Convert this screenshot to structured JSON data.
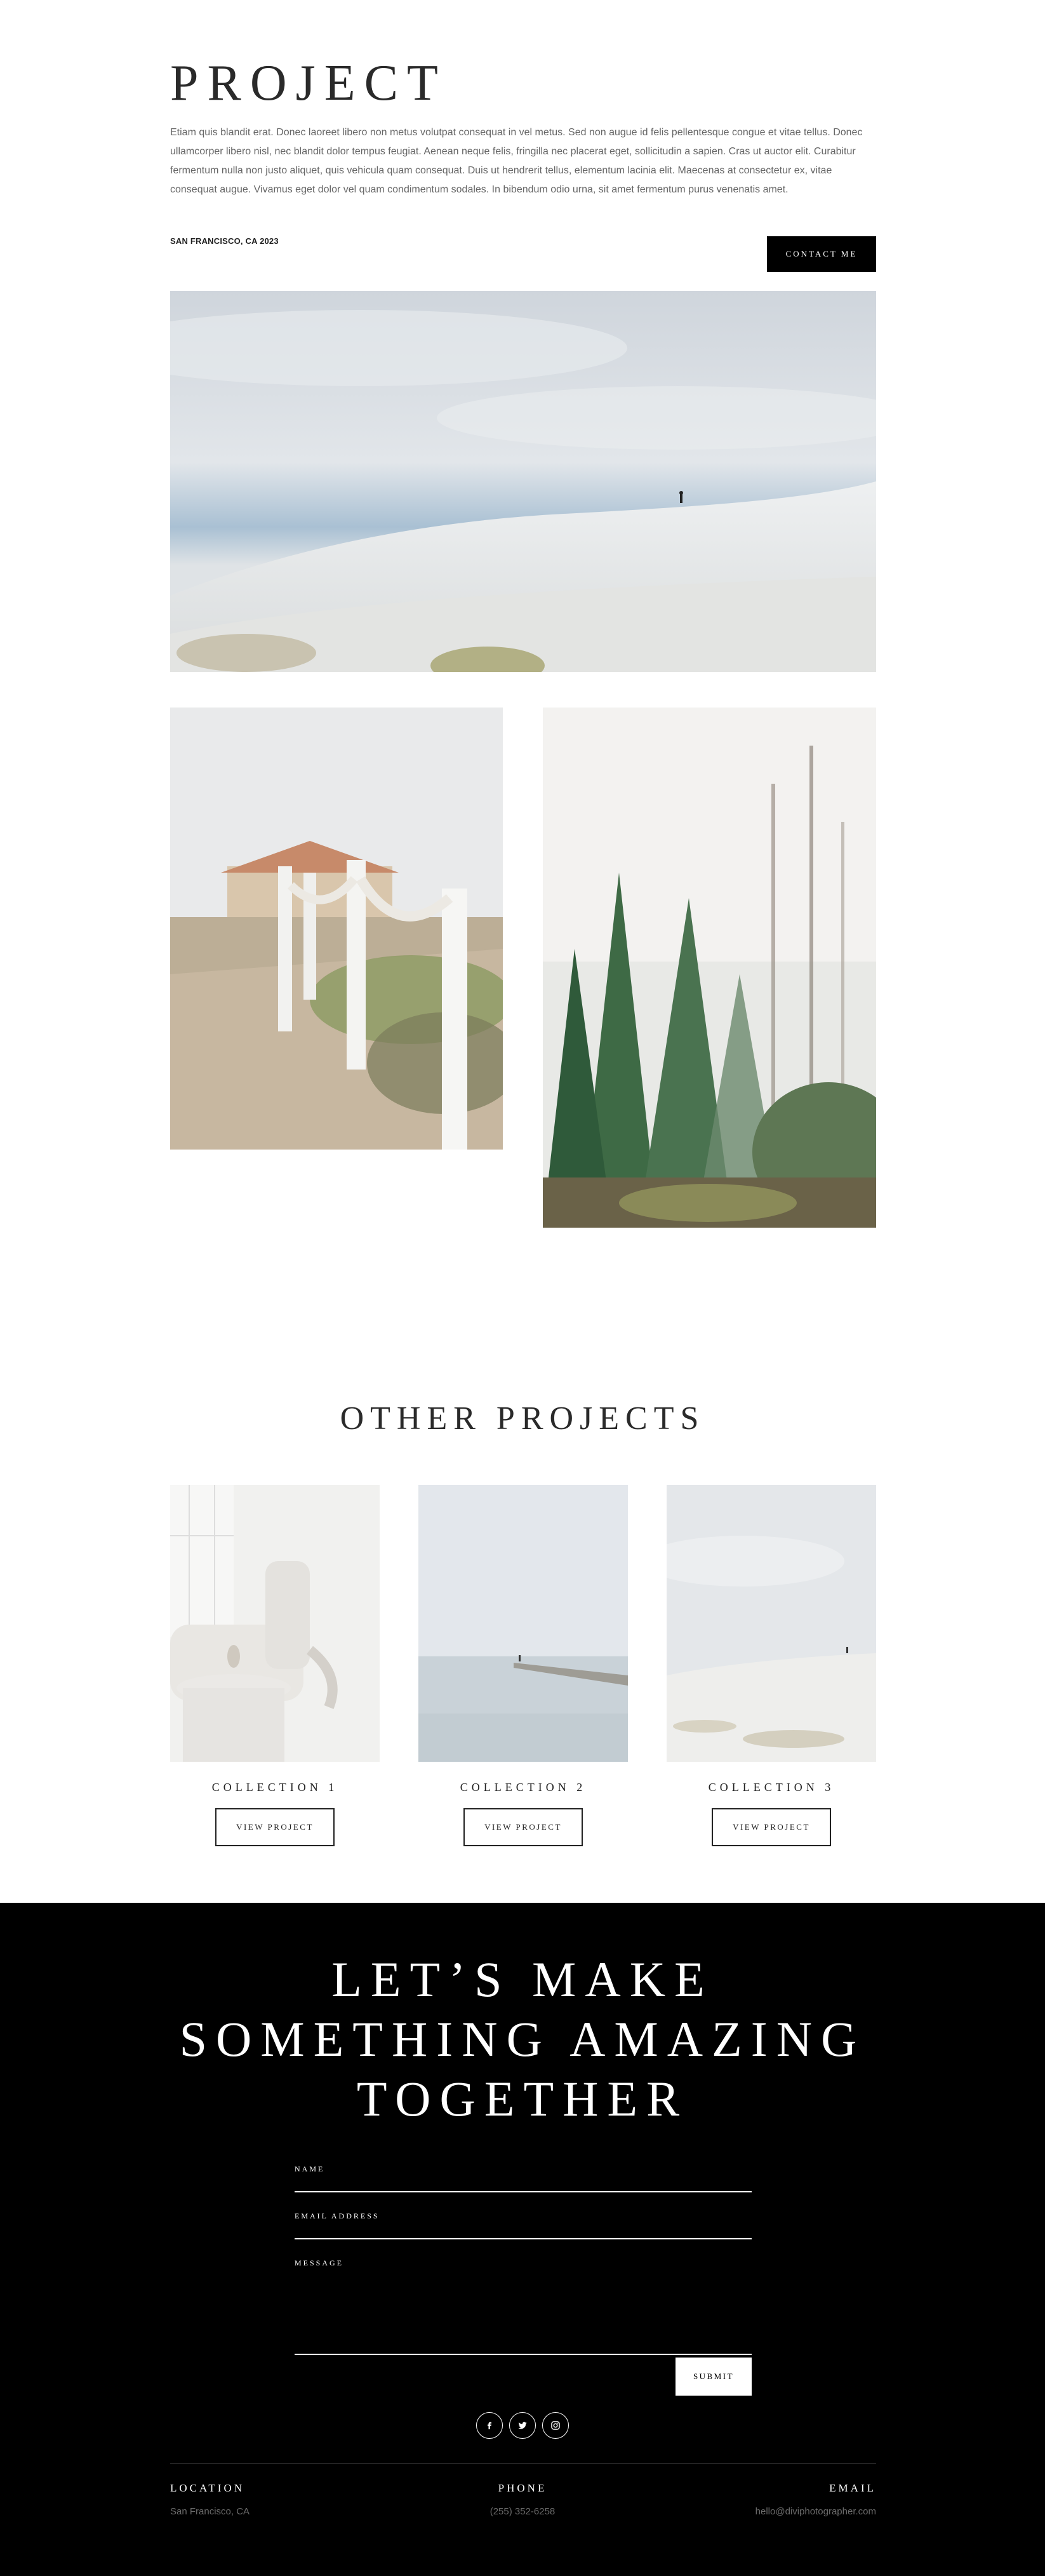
{
  "hero": {
    "title": "PROJECT",
    "intro": "Etiam quis blandit erat. Donec laoreet libero non metus volutpat consequat in vel metus. Sed non augue id felis pellentesque congue et vitae tellus. Donec ullamcorper libero nisl, nec blandit dolor tempus feugiat. Aenean neque felis, fringilla nec placerat eget, sollicitudin a sapien. Cras ut auctor elit. Curabitur fermentum nulla non justo aliquet, quis vehicula quam consequat. Duis ut hendrerit tellus, elementum lacinia elit. Maecenas at consectetur ex, vitae consequat augue. Vivamus eget dolor vel quam condimentum sodales. In bibendum odio urna, sit amet fermentum purus venenatis amet.",
    "location": "SAN FRANCISCO, CA 2023",
    "contact_label": "CONTACT ME"
  },
  "other": {
    "title": "OTHER PROJECTS",
    "cards": [
      {
        "title": "COLLECTION 1",
        "button": "VIEW PROJECT"
      },
      {
        "title": "COLLECTION 2",
        "button": "VIEW PROJECT"
      },
      {
        "title": "COLLECTION 3",
        "button": "VIEW PROJECT"
      }
    ]
  },
  "cta": {
    "line1": "LET’S MAKE",
    "line2": "SOMETHING AMAZING",
    "line3": "TOGETHER"
  },
  "form": {
    "name_label": "NAME",
    "email_label": "EMAIL ADDRESS",
    "message_label": "MESSAGE",
    "submit_label": "SUBMIT"
  },
  "socials": [
    "facebook-icon",
    "twitter-icon",
    "instagram-icon"
  ],
  "footer": {
    "location_heading": "LOCATION",
    "location_value": "San Francisco, CA",
    "phone_heading": "PHONE",
    "phone_value": "(255) 352-6258",
    "email_heading": "EMAIL",
    "email_value": "hello@diviphotographer.com"
  },
  "colors": {
    "background": "#ffffff",
    "footer_bg": "#000000",
    "accent": "#000000",
    "muted_text": "#666666"
  }
}
